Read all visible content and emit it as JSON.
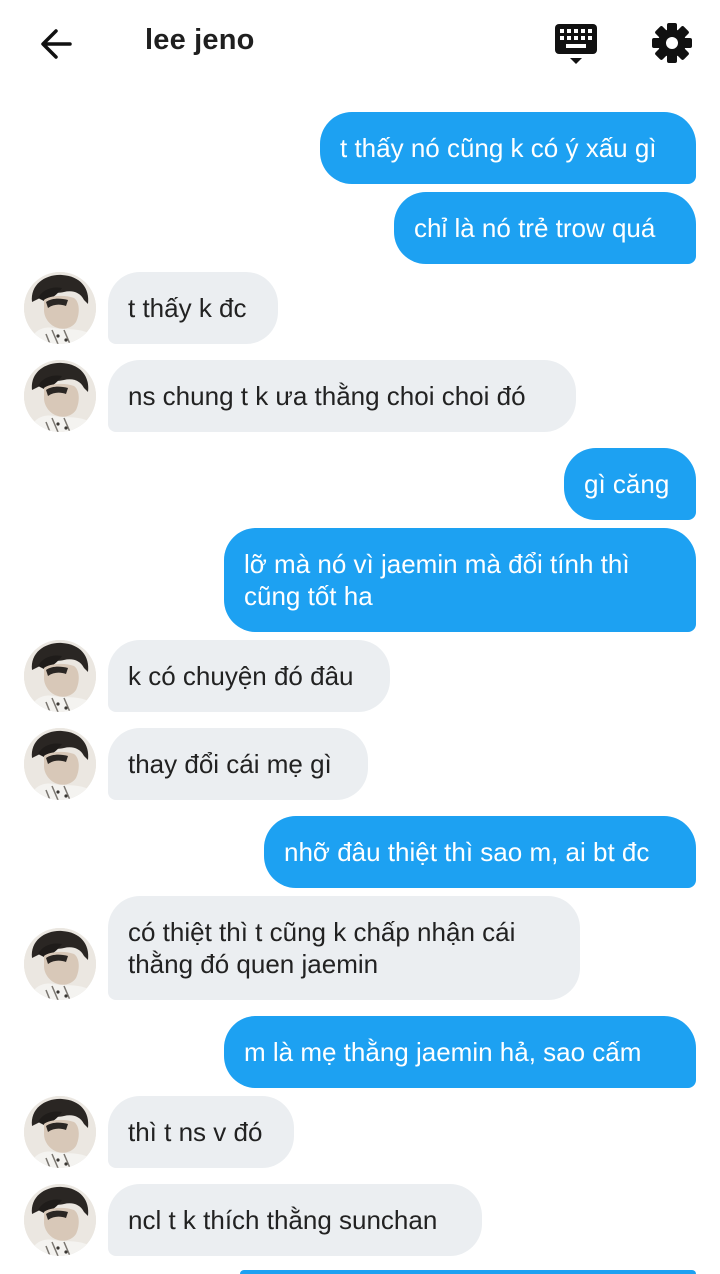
{
  "header": {
    "contact_name": "lee jeno",
    "back_icon": "arrow-left-icon",
    "keyboard_icon": "keyboard-icon",
    "settings_icon": "gear-icon"
  },
  "colors": {
    "sent_bubble": "#1da1f2",
    "received_bubble": "#ebeef1"
  },
  "messages": [
    {
      "from": "me",
      "text": "t thấy nó cũng k có ý xấu gì"
    },
    {
      "from": "me",
      "text": "chỉ là nó trẻ trow quá"
    },
    {
      "from": "them",
      "text": "t thấy k đc"
    },
    {
      "from": "them",
      "text": "ns chung t k ưa thằng choi choi đó"
    },
    {
      "from": "me",
      "text": "gì căng"
    },
    {
      "from": "me",
      "text": "lỡ mà nó vì jaemin mà đổi tính thì cũng tốt ha"
    },
    {
      "from": "them",
      "text": "k có chuyện đó đâu"
    },
    {
      "from": "them",
      "text": "thay đổi cái mẹ gì"
    },
    {
      "from": "me",
      "text": "nhỡ đâu thiệt thì sao m, ai bt đc"
    },
    {
      "from": "them",
      "text": "có thiệt thì t cũng k chấp nhận cái thằng đó quen jaemin"
    },
    {
      "from": "me",
      "text": "m là mẹ thằng jaemin hả, sao cấm"
    },
    {
      "from": "them",
      "text": "thì t ns v đó"
    },
    {
      "from": "them",
      "text": "ncl t k thích thằng sunchan"
    }
  ]
}
